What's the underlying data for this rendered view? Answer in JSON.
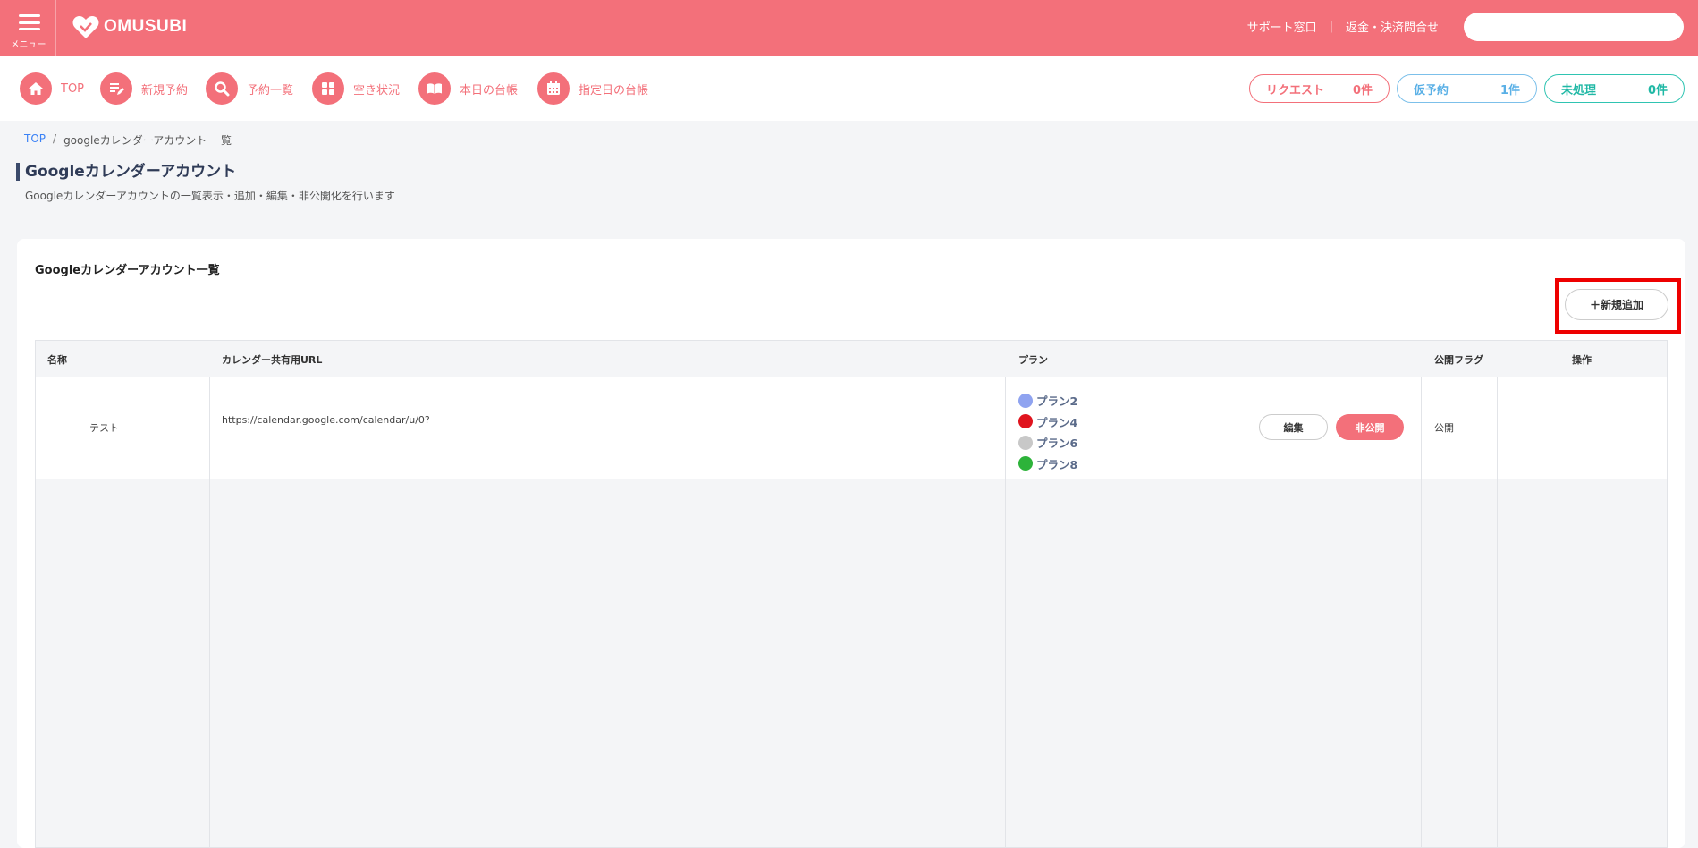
{
  "header": {
    "menu_label": "メニュー",
    "logo_text": "OMUSUBI",
    "links": [
      "サポート窓口",
      "返金・決済問合せ"
    ],
    "link_separator": "|",
    "search_value": "",
    "brand_color": "#f3707a"
  },
  "nav": {
    "items": [
      {
        "label": "TOP",
        "icon": "home-icon"
      },
      {
        "label": "新規予約",
        "icon": "edit-icon"
      },
      {
        "label": "予約一覧",
        "icon": "search-icon"
      },
      {
        "label": "空き状況",
        "icon": "grid-icon"
      },
      {
        "label": "本日の台帳",
        "icon": "book-icon"
      },
      {
        "label": "指定日の台帳",
        "icon": "calendar-icon"
      }
    ],
    "badges": [
      {
        "label": "リクエスト",
        "count": "0件",
        "color": "#f3707a"
      },
      {
        "label": "仮予約",
        "count": "1件",
        "color": "#5ab0e6"
      },
      {
        "label": "未処理",
        "count": "0件",
        "color": "#1fb8a5"
      }
    ]
  },
  "breadcrumb": {
    "top": "TOP",
    "separator": "/",
    "current": "googleカレンダーアカウント 一覧"
  },
  "page": {
    "title": "Googleカレンダーアカウント",
    "description": "Googleカレンダーアカウントの一覧表示・追加・編集・非公開化を行います"
  },
  "card": {
    "title": "Googleカレンダーアカウント一覧",
    "add_button": "＋新規追加"
  },
  "table": {
    "headers": [
      "名称",
      "カレンダー共有用URL",
      "プラン",
      "公開フラグ",
      "操作"
    ],
    "rows": [
      {
        "name": "テスト",
        "url": "https://calendar.google.com/calendar/u/0?",
        "plans": [
          {
            "label": "プラン2",
            "color": "#8fa3f0"
          },
          {
            "label": "プラン4",
            "color": "#e0141e"
          },
          {
            "label": "プラン6",
            "color": "#c8c8c8"
          },
          {
            "label": "プラン8",
            "color": "#2db33a"
          }
        ],
        "public_flag": "公開",
        "edit_label": "編集",
        "hide_label": "非公開"
      }
    ]
  }
}
